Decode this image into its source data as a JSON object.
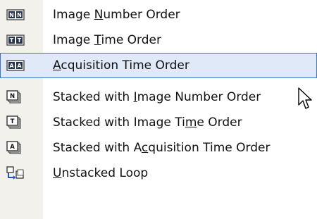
{
  "menu": {
    "items": [
      {
        "icon": "image-number-order-icon",
        "pre": "Image ",
        "ul": "N",
        "post": "umber Order"
      },
      {
        "icon": "image-time-order-icon",
        "pre": "Image ",
        "ul": "T",
        "post": "ime Order"
      },
      {
        "icon": "acquisition-time-order-icon",
        "pre": "",
        "ul": "A",
        "post": "cquisition Time Order"
      },
      {
        "icon": "stacked-image-number-order-icon",
        "pre": "Stacked with ",
        "ul": "I",
        "post": "mage Number Order"
      },
      {
        "icon": "stacked-image-time-order-icon",
        "pre": "Stacked with Image Ti",
        "ul": "m",
        "post": "e Order"
      },
      {
        "icon": "stacked-acquisition-time-order-icon",
        "pre": "Stacked with A",
        "ul": "c",
        "post": "quisition Time Order"
      },
      {
        "icon": "unstacked-loop-icon",
        "pre": "",
        "ul": "U",
        "post": "nstacked Loop"
      }
    ],
    "highlighted_index": 2,
    "colors": {
      "highlight_bg": "#dfe9f7",
      "highlight_border": "#3d72c9",
      "gutter": "#f3f1eb"
    }
  }
}
